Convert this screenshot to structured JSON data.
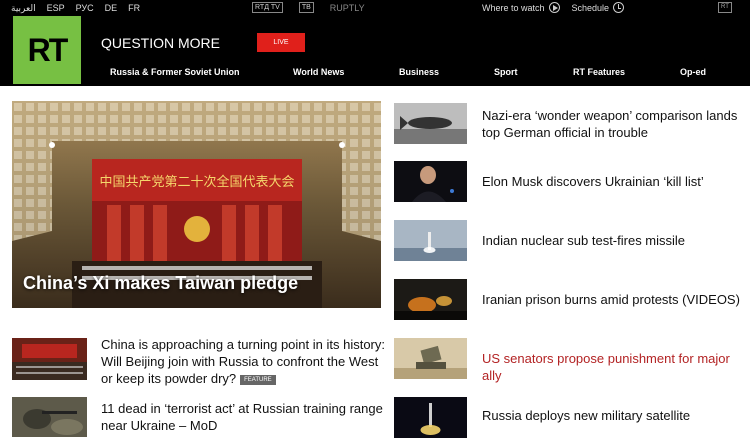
{
  "topbar": {
    "languages": [
      "العربية",
      "ESP",
      "РУС",
      "DE",
      "FR"
    ],
    "channels": [
      "RTД TV",
      "ТВ",
      "RUPTLY"
    ],
    "where_to_watch": "Where to watch",
    "schedule": "Schedule",
    "rt_mini": "RT"
  },
  "header": {
    "logo": "RT",
    "tagline": "QUESTION MORE",
    "live": "LIVE"
  },
  "nav": [
    "Russia & Former Soviet Union",
    "World News",
    "Business",
    "Sport",
    "RT Features",
    "Op-ed"
  ],
  "hero": {
    "title": "China’s Xi makes Taiwan pledge",
    "banner_text": "中国共产党第二十次全国代表大会"
  },
  "left_stories": [
    {
      "title": "China is approaching a turning point in its history: Will Beijing join with Russia to confront the West or keep its powder dry?",
      "badge": "FEATURE"
    },
    {
      "title": "11 dead in ‘terrorist act’ at Russian training range near Ukraine – MoD"
    }
  ],
  "right_stories": [
    {
      "title": "Nazi-era ‘wonder weapon’ comparison lands top German official in trouble",
      "color": "#111111"
    },
    {
      "title": "Elon Musk discovers Ukrainian ‘kill list’",
      "color": "#111111"
    },
    {
      "title": "Indian nuclear sub test-fires missile",
      "color": "#111111"
    },
    {
      "title": "Iranian prison burns amid protests (VIDEOS)",
      "color": "#111111"
    },
    {
      "title": "US senators propose punishment for major ally",
      "color": "#b32324"
    },
    {
      "title": "Russia deploys new military satellite",
      "color": "#111111"
    }
  ],
  "colors": {
    "brand_green": "#77c043",
    "live_red": "#e0201b",
    "link_red": "#b32324"
  }
}
